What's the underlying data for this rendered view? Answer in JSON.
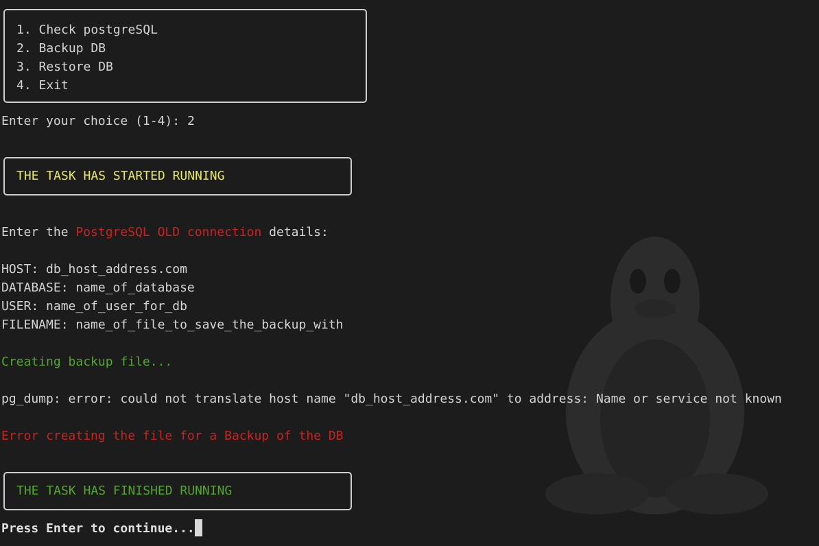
{
  "menu": {
    "items": [
      "1. Check postgreSQL",
      "2. Backup DB",
      "3. Restore DB",
      "4. Exit"
    ]
  },
  "prompt": {
    "label": "Enter your choice (1-4): ",
    "value": "2"
  },
  "status_start": "THE TASK HAS STARTED RUNNING",
  "connection": {
    "prefix": "Enter the ",
    "highlight": "PostgreSQL OLD connection",
    "suffix": " details:"
  },
  "fields": {
    "host": "HOST: db_host_address.com",
    "database": "DATABASE: name_of_database",
    "user": "USER: name_of_user_for_db",
    "filename": "FILENAME: name_of_file_to_save_the_backup_with"
  },
  "creating": "Creating backup file...",
  "pg_error": "pg_dump: error: could not translate host name \"db_host_address.com\" to address: Name or service not known",
  "backup_error": "Error creating the file for a Backup of the DB",
  "status_end": "THE TASK HAS FINISHED RUNNING",
  "continue_prompt": "Press Enter to continue...",
  "colors": {
    "background": "#1c1c1c",
    "text": "#d4d4d4",
    "yellow": "#e8e85a",
    "green": "#55a532",
    "red": "#cc2222"
  },
  "watermark_icon": "tux-penguin-icon"
}
